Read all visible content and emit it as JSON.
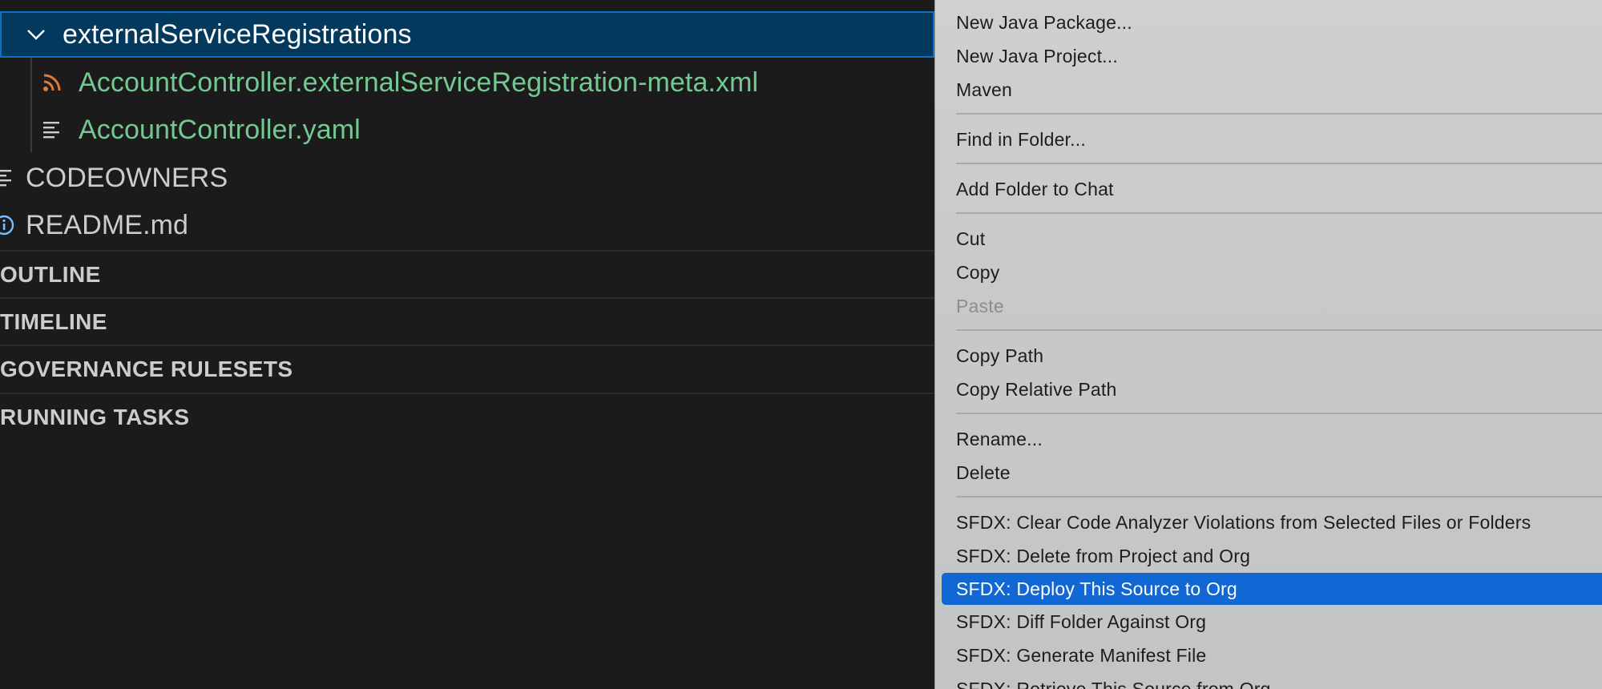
{
  "explorer": {
    "folder": {
      "label": "externalServiceRegistrations"
    },
    "files": [
      {
        "label": "AccountController.externalServiceRegistration-meta.xml",
        "icon": "rss-icon"
      },
      {
        "label": "AccountController.yaml",
        "icon": "lines-icon"
      }
    ],
    "root_files": [
      {
        "label": "CODEOWNERS",
        "icon": "lines-icon"
      },
      {
        "label": "README.md",
        "icon": "info-icon"
      }
    ],
    "sections": [
      "OUTLINE",
      "TIMELINE",
      "GOVERNANCE RULESETS",
      "RUNNING TASKS"
    ]
  },
  "context_menu": {
    "items": [
      "New Java Package...",
      "New Java Project...",
      "Maven",
      "Find in Folder...",
      "Add Folder to Chat",
      "Cut",
      "Copy",
      "Paste",
      "Copy Path",
      "Copy Relative Path",
      "Rename...",
      "Delete",
      "SFDX: Clear Code Analyzer Violations from Selected Files or Folders",
      "SFDX: Delete from Project and Org",
      "SFDX: Deploy This Source to Org",
      "SFDX: Diff Folder Against Org",
      "SFDX: Generate Manifest File",
      "SFDX: Retrieve This Source from Org"
    ],
    "highlighted": "SFDX: Deploy This Source to Org",
    "disabled": [
      "Paste"
    ]
  },
  "colors": {
    "selection_bg": "#04395e",
    "selection_border": "#0e70c0",
    "git_added_text": "#73c991",
    "rss_icon": "#e37933",
    "info_icon": "#75beff",
    "menu_highlight": "#1167d3"
  }
}
